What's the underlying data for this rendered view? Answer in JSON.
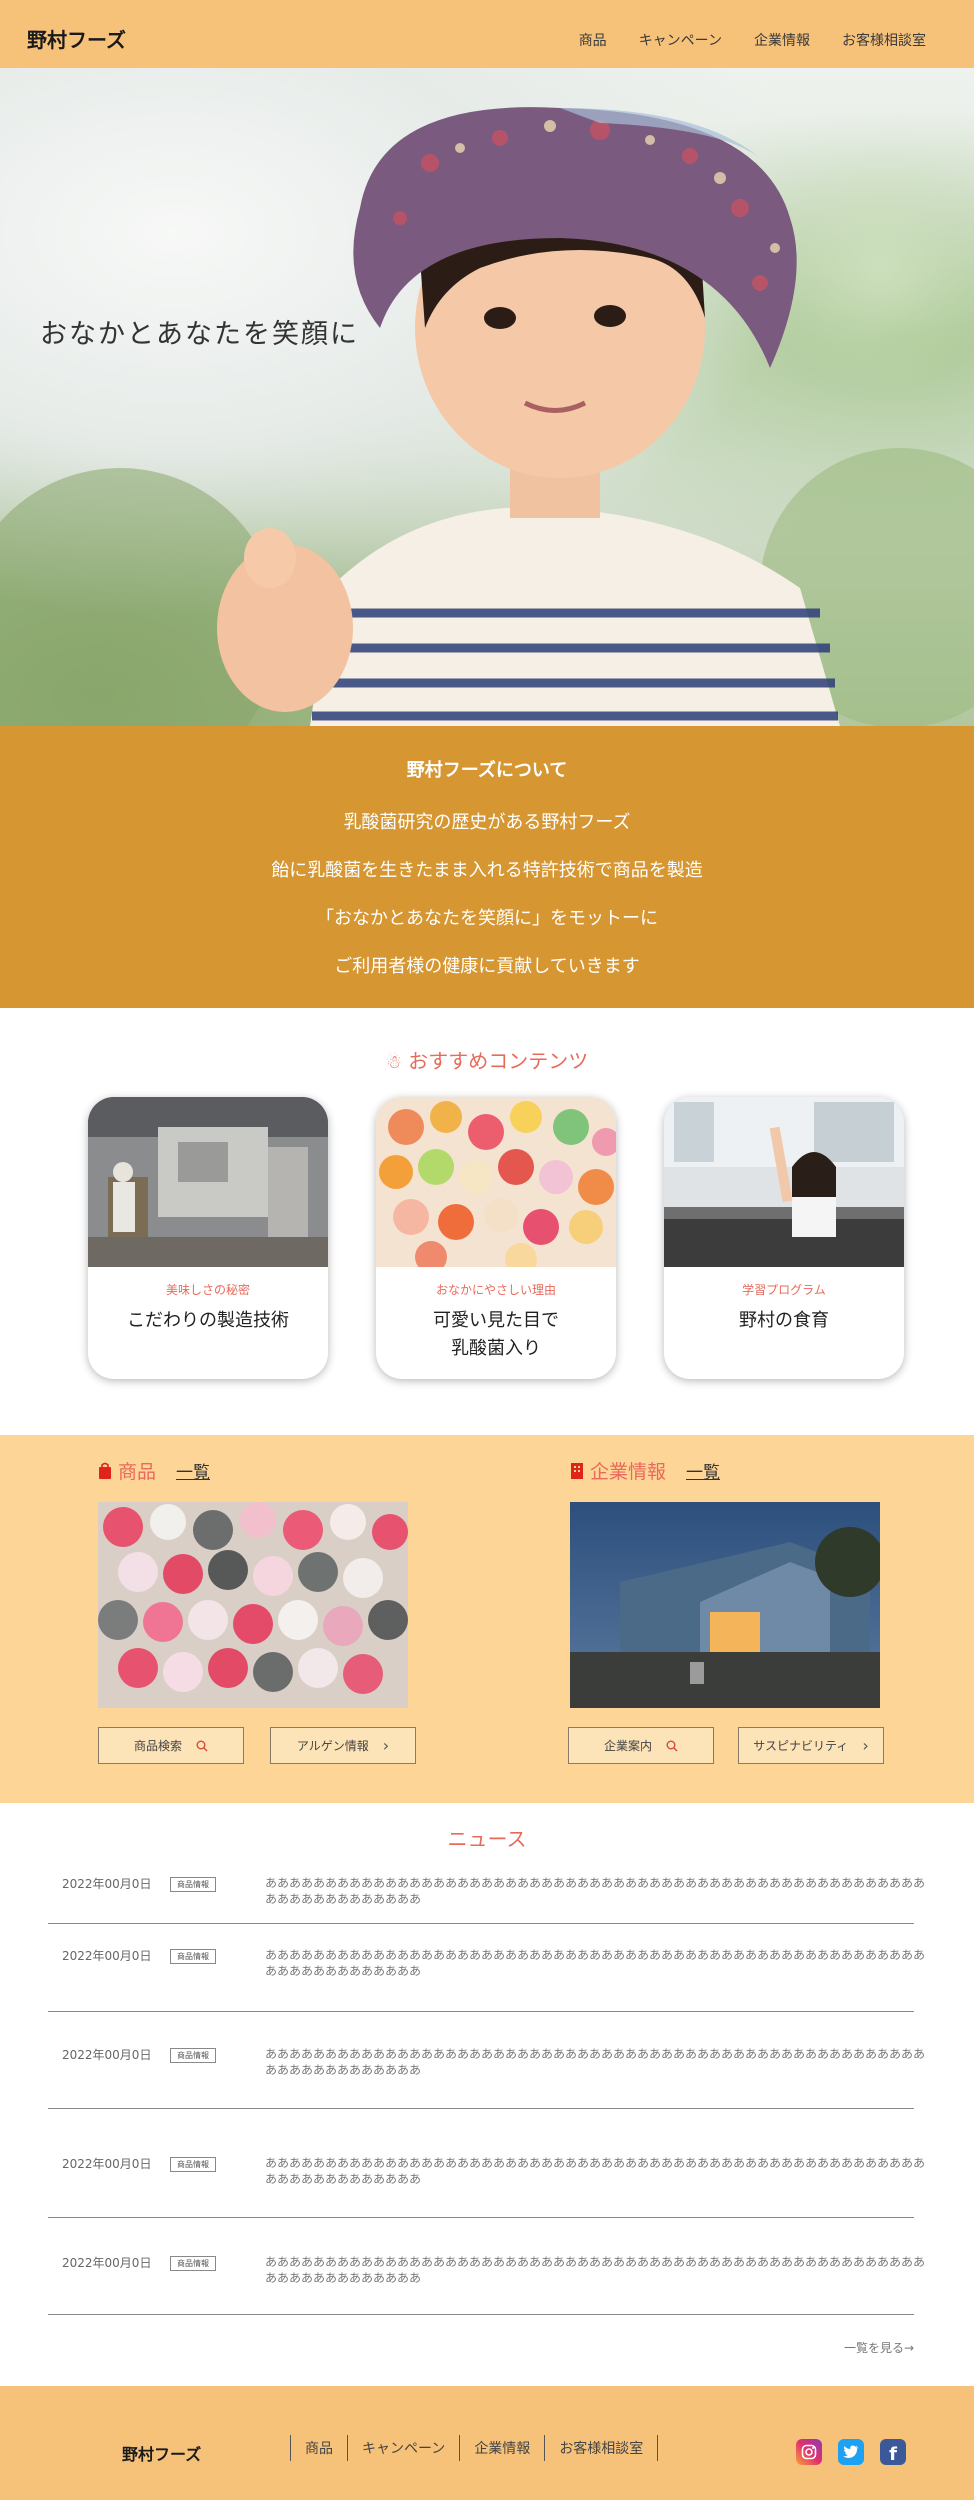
{
  "header": {
    "logo": "野村フーズ",
    "nav": [
      "商品",
      "キャンペーン",
      "企業情報",
      "お客様相談室"
    ]
  },
  "hero": {
    "tagline": "おなかとあなたを笑顔に"
  },
  "about": {
    "title": "野村フーズについて",
    "lines": [
      "乳酸菌研究の歴史がある野村フーズ",
      "飴に乳酸菌を生きたまま入れる特許技術で商品を製造",
      "「おなかとあなたを笑顔に」をモットーに",
      "ご利用者様の健康に貢献していきます"
    ]
  },
  "recommend": {
    "title": "おすすめコンテンツ",
    "cards": [
      {
        "sub": "美味しさの秘密",
        "title": "こだわりの製造技術"
      },
      {
        "sub": "おなかにやさしい理由",
        "title": "可愛い見た目で\n乳酸菌入り"
      },
      {
        "sub": "学習プログラム",
        "title": "野村の食育"
      }
    ]
  },
  "products": {
    "title": "商品",
    "all": "一覧",
    "buttons": [
      "商品検索",
      "アルゲン情報"
    ]
  },
  "company": {
    "title": "企業情報",
    "all": "一覧",
    "buttons": [
      "企業案内",
      "サスピナビリティ"
    ]
  },
  "news": {
    "title": "ニュース",
    "items": [
      {
        "date": "2022年00月0日",
        "badge": "商品情報",
        "text": "ああああああああああああああああああああああああああああああああああああああああああああああああああああああああああああああああああああ"
      },
      {
        "date": "2022年00月0日",
        "badge": "商品情報",
        "text": "ああああああああああああああああああああああああああああああああああああああああああああああああああああああああああああああああああああ"
      },
      {
        "date": "2022年00月0日",
        "badge": "商品情報",
        "text": "ああああああああああああああああああああああああああああああああああああああああああああああああああああああああああああああああああああ"
      },
      {
        "date": "2022年00月0日",
        "badge": "商品情報",
        "text": "ああああああああああああああああああああああああああああああああああああああああああああああああああああああああああああああああああああ"
      },
      {
        "date": "2022年00月0日",
        "badge": "商品情報",
        "text": "ああああああああああああああああああああああああああああああああああああああああああああああああああああああああああああああああああああ"
      }
    ],
    "more": "一覧を見る→"
  },
  "footer": {
    "logo": "野村フーズ",
    "nav": [
      "商品",
      "キャンペーン",
      "企業情報",
      "お客様相談室"
    ],
    "social": [
      "instagram-icon",
      "twitter-icon",
      "facebook-icon"
    ]
  },
  "colors": {
    "header": "#f6c27a",
    "about": "#d69733",
    "accent": "#e86a5b",
    "pc_bg": "#fdd597"
  }
}
